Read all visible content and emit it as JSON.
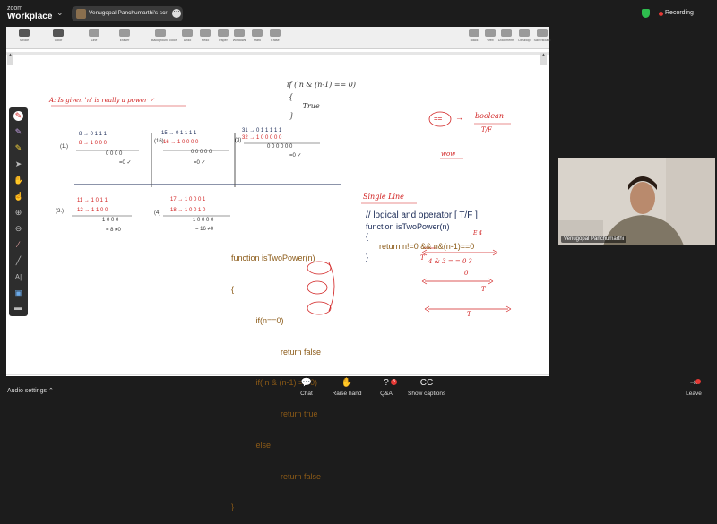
{
  "app": {
    "brand_small": "zoom",
    "brand_big": "Workplace"
  },
  "share": {
    "text": "Venugopal Panchumarthi's screen"
  },
  "recording": {
    "label": "Recording",
    "color": "#e53935"
  },
  "toolbar": {
    "items": [
      {
        "label": "Stroke",
        "icon": "pen-icon"
      },
      {
        "label": "Color",
        "icon": "palette-icon"
      },
      {
        "label": "Line",
        "icon": "line-icon"
      },
      {
        "label": "Eraser",
        "icon": "eraser-icon"
      },
      {
        "label": "Background color",
        "icon": "fill-icon"
      },
      {
        "label": "Undo",
        "icon": "undo-icon"
      },
      {
        "label": "Redo",
        "icon": "redo-icon"
      },
      {
        "label": "Paper",
        "icon": "paper-icon"
      },
      {
        "label": "Windows",
        "icon": "windows-icon"
      },
      {
        "label": "Mark",
        "icon": "mark-icon"
      },
      {
        "label": "Erase",
        "icon": "erase-icon"
      },
      {
        "label": "Black",
        "icon": "black-icon"
      },
      {
        "label": "Web",
        "icon": "web-icon"
      },
      {
        "label": "Documents",
        "icon": "documents-icon"
      },
      {
        "label": "Desktop",
        "icon": "desktop-icon"
      },
      {
        "label": "Save/Board",
        "icon": "save-icon"
      }
    ]
  },
  "board": {
    "heading": "A: Is given 'n' is really a power ✓",
    "top_code": [
      "if ( n & (n-1) == 0)",
      "{",
      "   True",
      "}"
    ],
    "examples_row1": [
      {
        "label": "(1.)",
        "lines": [
          "8 → 0 1 1 1",
          "8 → 1 0 0 0",
          "0 0 0 0",
          "=0 ✓"
        ]
      },
      {
        "label": "(16)",
        "lines": [
          "15 → 0 1 1 1 1",
          "16 → 1 0 0 0 0",
          "0 0 0 0 0",
          "=0 ✓"
        ]
      },
      {
        "label": "(3)",
        "lines": [
          "31 → 0 1 1 1 1 1",
          "32 → 1 0 0 0 0 0",
          "0 0 0 0 0 0",
          "=0 ✓"
        ]
      }
    ],
    "examples_row2": [
      {
        "label": "(3.)",
        "lines": [
          "11 → 1 0 1 1",
          "12 → 1 1 0 0",
          "1 0 0 0",
          "= 8 ≠0"
        ]
      },
      {
        "label": "(4)",
        "lines": [
          "17 → 1 0 0 0 1",
          "18 → 1 0 0 1 0",
          "1 0 0 0 0",
          "= 16 ≠0"
        ]
      }
    ],
    "right_note": {
      "symbol": "==",
      "arrow": "→",
      "word": "boolean",
      "sub": "T/F",
      "wow": "wow"
    },
    "single_line": "Single Line",
    "code_left": [
      "function isTwoPower(n)",
      "{",
      "           if(n==0)",
      "                      return false",
      "           if( n & (n-1) == 0)",
      "                      return true",
      "           else",
      "                      return false",
      "}"
    ],
    "code_right": [
      "// logical and operator [ T/F ]",
      "function isTwoPower(n)",
      "{",
      "      return n!=0 && n&(n-1)==0",
      "",
      "}"
    ],
    "ann": {
      "t1": "T",
      "t2": "T",
      "t3": "T",
      "expr": "4 & 3 = = 0 ?",
      "zero": "0",
      "e4": "E 4"
    }
  },
  "video": {
    "name": "Venugopal Panchumarthi"
  },
  "bottom": {
    "audio": "Audio settings",
    "chat": "Chat",
    "raise": "Raise hand",
    "qa": "Q&A",
    "qa_count": "3",
    "captions": "Show captions",
    "leave": "Leave"
  }
}
